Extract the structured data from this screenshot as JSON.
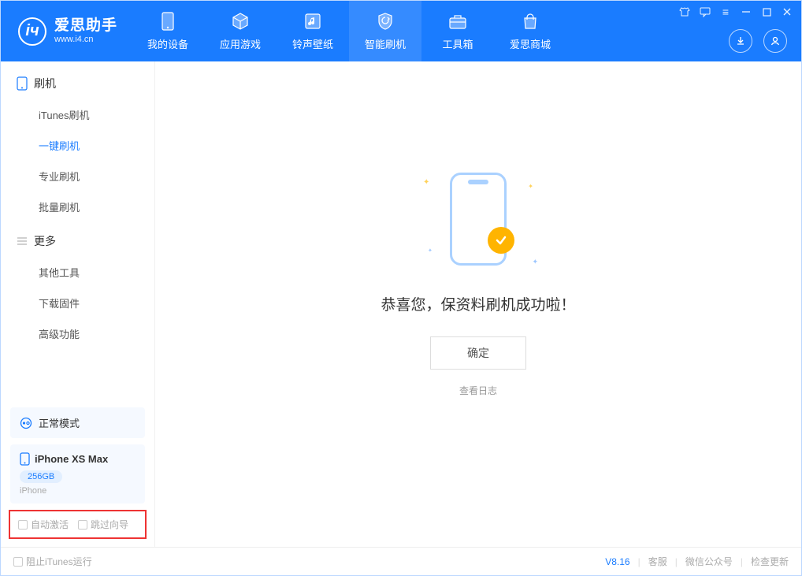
{
  "app": {
    "name": "爱思助手",
    "domain": "www.i4.cn"
  },
  "nav": {
    "tabs": [
      {
        "label": "我的设备"
      },
      {
        "label": "应用游戏"
      },
      {
        "label": "铃声壁纸"
      },
      {
        "label": "智能刷机"
      },
      {
        "label": "工具箱"
      },
      {
        "label": "爱思商城"
      }
    ]
  },
  "sidebar": {
    "section1_title": "刷机",
    "items1": [
      {
        "label": "iTunes刷机"
      },
      {
        "label": "一键刷机"
      },
      {
        "label": "专业刷机"
      },
      {
        "label": "批量刷机"
      }
    ],
    "section2_title": "更多",
    "items2": [
      {
        "label": "其他工具"
      },
      {
        "label": "下载固件"
      },
      {
        "label": "高级功能"
      }
    ],
    "mode_label": "正常模式",
    "device": {
      "name": "iPhone XS Max",
      "storage": "256GB",
      "type": "iPhone"
    },
    "options": {
      "auto_activate": "自动激活",
      "skip_guide": "跳过向导"
    }
  },
  "content": {
    "success_msg": "恭喜您，保资料刷机成功啦！",
    "ok_label": "确定",
    "log_link": "查看日志"
  },
  "footer": {
    "block_itunes": "阻止iTunes运行",
    "version": "V8.16",
    "links": {
      "support": "客服",
      "wechat": "微信公众号",
      "update": "检查更新"
    }
  }
}
